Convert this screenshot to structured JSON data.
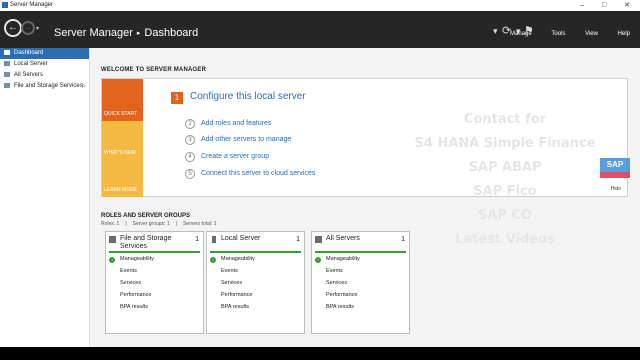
{
  "window": {
    "title": "Server Manager",
    "controls": "– □ ✕"
  },
  "header": {
    "history_icon": "▾",
    "app": "Server Manager",
    "arrow": "▸",
    "page": "Dashboard",
    "menus": [
      "Manage",
      "Tools",
      "View",
      "Help"
    ]
  },
  "sidebar": {
    "items": [
      {
        "label": "Dashboard",
        "active": true
      },
      {
        "label": "Local Server"
      },
      {
        "label": "All Servers"
      },
      {
        "label": "File and Storage Services",
        "caret": "▷"
      }
    ]
  },
  "welcome": {
    "title": "WELCOME TO SERVER MANAGER",
    "tiles": [
      "QUICK START",
      "WHAT'S NEW",
      "LEARN MORE"
    ],
    "steps": [
      {
        "num": "1",
        "label": "Configure this local server"
      },
      {
        "num": "2",
        "label": "Add roles and features"
      },
      {
        "num": "3",
        "label": "Add other servers to manage"
      },
      {
        "num": "4",
        "label": "Create a server group"
      },
      {
        "num": "5",
        "label": "Connect this server to cloud services"
      }
    ],
    "hide": "Hide"
  },
  "groups": {
    "title": "ROLES AND SERVER GROUPS",
    "summary": [
      "Roles: 1",
      "|",
      "Server groups: 1",
      "|",
      "Servers total: 1"
    ],
    "cards": [
      {
        "name": "File and Storage Services",
        "count": "1",
        "rows": [
          "Manageability",
          "Events",
          "Services",
          "Performance",
          "BPA results"
        ]
      },
      {
        "name": "Local Server",
        "count": "1",
        "rows": [
          "Manageability",
          "Events",
          "Services",
          "Performance",
          "BPA results"
        ]
      },
      {
        "name": "All Servers",
        "count": "1",
        "rows": [
          "Manageability",
          "Events",
          "Services",
          "Performance",
          "BPA results"
        ]
      }
    ]
  },
  "watermark": {
    "lines": [
      "Contact for",
      "S4 HANA Simple Finance",
      "SAP ABAP",
      "SAP Fico",
      "SAP CO",
      "Latest Videos"
    ],
    "logo": "SAP"
  },
  "colors": {
    "accent": "#2a6fb2",
    "quick_start": "#e2631b",
    "tiles": "#f5b942",
    "status_ok": "#3a9a3a",
    "navbar": "#262626"
  }
}
